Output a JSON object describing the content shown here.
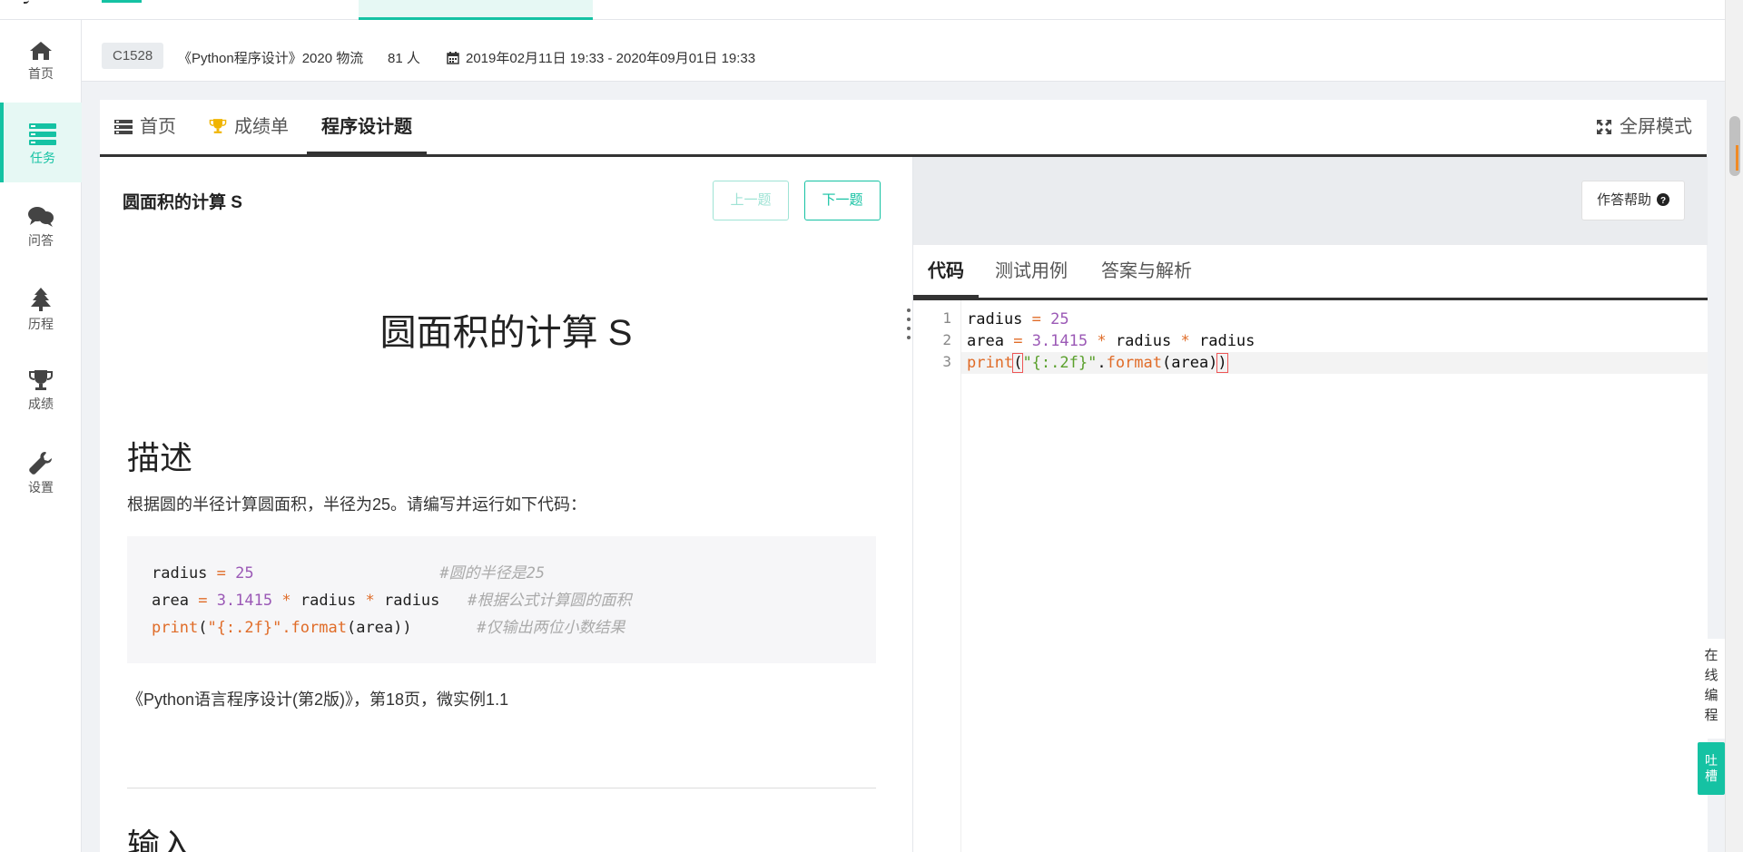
{
  "sidebar": {
    "items": [
      {
        "label": "首页",
        "icon": "home-icon"
      },
      {
        "label": "任务",
        "icon": "tasks-icon",
        "active": true
      },
      {
        "label": "问答",
        "icon": "comments-icon"
      },
      {
        "label": "历程",
        "icon": "tree-icon"
      },
      {
        "label": "成绩",
        "icon": "trophy-icon"
      },
      {
        "label": "设置",
        "icon": "wrench-icon"
      }
    ]
  },
  "info": {
    "code": "C1528",
    "course": "《Python程序设计》2020 物流",
    "people": "81 人",
    "time": "2019年02月11日 19:33 - 2020年09月01日 19:33"
  },
  "tabs": {
    "home": "首页",
    "scores": "成绩单",
    "programming": "程序设计题",
    "fullscreen": "全屏模式"
  },
  "problem": {
    "title": "圆面积的计算 S",
    "prev": "上一题",
    "next": "下一题",
    "heading": "圆面积的计算 S",
    "desc_heading": "描述",
    "desc": "根据圆的半径计算圆面积，半径为25。请编写并运行如下代码：",
    "code_comments": [
      "#圆的半径是25",
      "#根据公式计算圆的面积",
      "#仅输出两位小数结果"
    ],
    "reference": "《Python语言程序设计(第2版)》，第18页，微实例1.1",
    "input_heading": "输入"
  },
  "editor_panel": {
    "help": "作答帮助",
    "tabs": [
      "代码",
      "测试用例",
      "答案与解析"
    ],
    "line_numbers": [
      "1",
      "2",
      "3"
    ]
  },
  "float": {
    "online": [
      "在",
      "线",
      "编",
      "程"
    ],
    "tucao": [
      "吐",
      "槽"
    ]
  },
  "colors": {
    "accent": "#15c2a3"
  }
}
